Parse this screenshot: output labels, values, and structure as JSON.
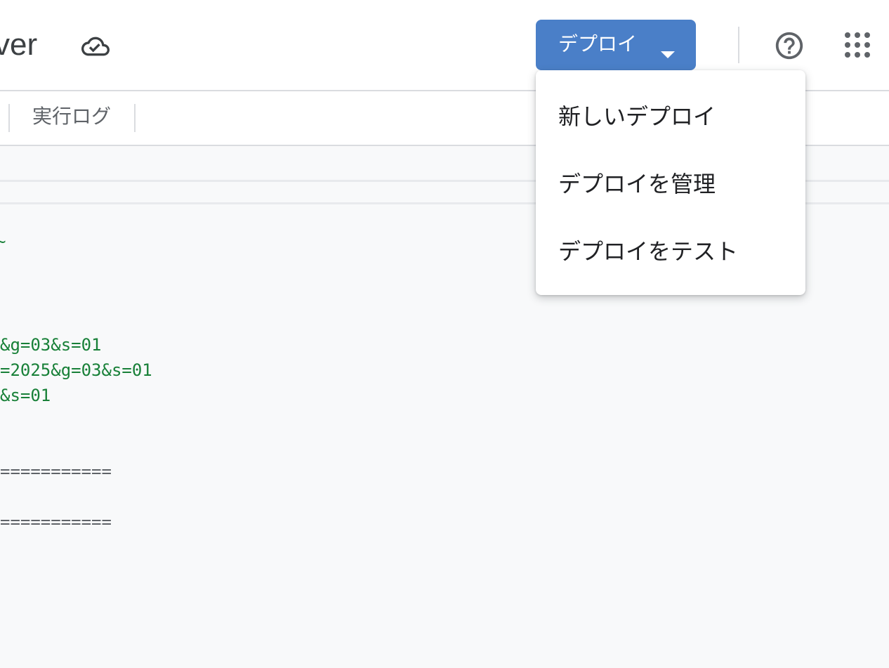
{
  "header": {
    "title": "ver",
    "deploy_label": "デプロイ"
  },
  "tabs": {
    "exec_log": "実行ログ"
  },
  "editor": {
    "lines": [
      {
        "text": "~",
        "color": "green"
      },
      {
        "text": "&g=03&s=01",
        "color": "green"
      },
      {
        "text": "=2025&g=03&s=01",
        "color": "green"
      },
      {
        "text": "&s=01",
        "color": "green"
      },
      {
        "text": "===========",
        "color": "gray"
      },
      {
        "text": "===========",
        "color": "gray"
      }
    ]
  },
  "deploy_menu": {
    "items": [
      {
        "label": "新しいデプロイ"
      },
      {
        "label": "デプロイを管理"
      },
      {
        "label": "デプロイをテスト"
      }
    ]
  },
  "colors": {
    "accent": "#4a7fc8",
    "code_string": "#188038"
  },
  "icons": {
    "cloud": "cloud-done-icon",
    "caret": "caret-down-icon",
    "help": "help-circle-icon",
    "apps": "apps-grid-icon"
  }
}
